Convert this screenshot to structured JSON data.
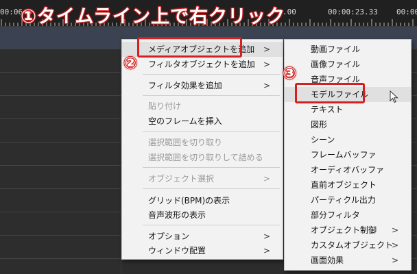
{
  "ruler": {
    "time_labels": [
      "00:06.6",
      ".00",
      "00:00:23.33",
      "00:00"
    ]
  },
  "callouts": {
    "step1": "①タイムライン上で右クリック",
    "step2": "②",
    "step3": "③"
  },
  "context_menu": {
    "items": [
      {
        "label": "メディアオブジェクトを追加",
        "submenu": true,
        "disabled": false
      },
      {
        "label": "フィルタオブジェクトを追加",
        "submenu": true,
        "disabled": false
      },
      {
        "label": "フィルタ効果を追加",
        "submenu": true,
        "disabled": false
      },
      {
        "label": "貼り付け",
        "submenu": false,
        "disabled": true
      },
      {
        "label": "空のフレームを挿入",
        "submenu": false,
        "disabled": false
      },
      {
        "label": "選択範囲を切り取り",
        "submenu": false,
        "disabled": true
      },
      {
        "label": "選択範囲を切り取りして詰める",
        "submenu": false,
        "disabled": true
      },
      {
        "label": "オブジェクト選択",
        "submenu": true,
        "disabled": true
      },
      {
        "label": "グリッド(BPM)の表示",
        "submenu": false,
        "disabled": false
      },
      {
        "label": "音声波形の表示",
        "submenu": false,
        "disabled": false
      },
      {
        "label": "オプション",
        "submenu": true,
        "disabled": false
      },
      {
        "label": "ウィンドウ配置",
        "submenu": true,
        "disabled": false
      }
    ]
  },
  "submenu": {
    "items": [
      {
        "label": "動画ファイル",
        "submenu": false
      },
      {
        "label": "画像ファイル",
        "submenu": false
      },
      {
        "label": "音声ファイル",
        "submenu": false
      },
      {
        "label": "モデルファイル",
        "submenu": false
      },
      {
        "label": "テキスト",
        "submenu": false
      },
      {
        "label": "図形",
        "submenu": false
      },
      {
        "label": "シーン",
        "submenu": false
      },
      {
        "label": "フレームバッファ",
        "submenu": false
      },
      {
        "label": "オーディオバッファ",
        "submenu": false
      },
      {
        "label": "直前オブジェクト",
        "submenu": false
      },
      {
        "label": "パーティクル出力",
        "submenu": false
      },
      {
        "label": "部分フィルタ",
        "submenu": false
      },
      {
        "label": "オブジェクト制御",
        "submenu": true
      },
      {
        "label": "カスタムオブジェクト",
        "submenu": true
      },
      {
        "label": "画面効果",
        "submenu": true
      }
    ]
  },
  "submenu_arrow": ">",
  "colors": {
    "annotation_red": "#d42020",
    "menu_bg": "#f2f2f2",
    "timeline_bg": "#2d2d2d",
    "layer_band": "#3b4352"
  },
  "icons": {
    "cursor": "mouse-pointer-icon",
    "submenu": "chevron-right-icon"
  }
}
